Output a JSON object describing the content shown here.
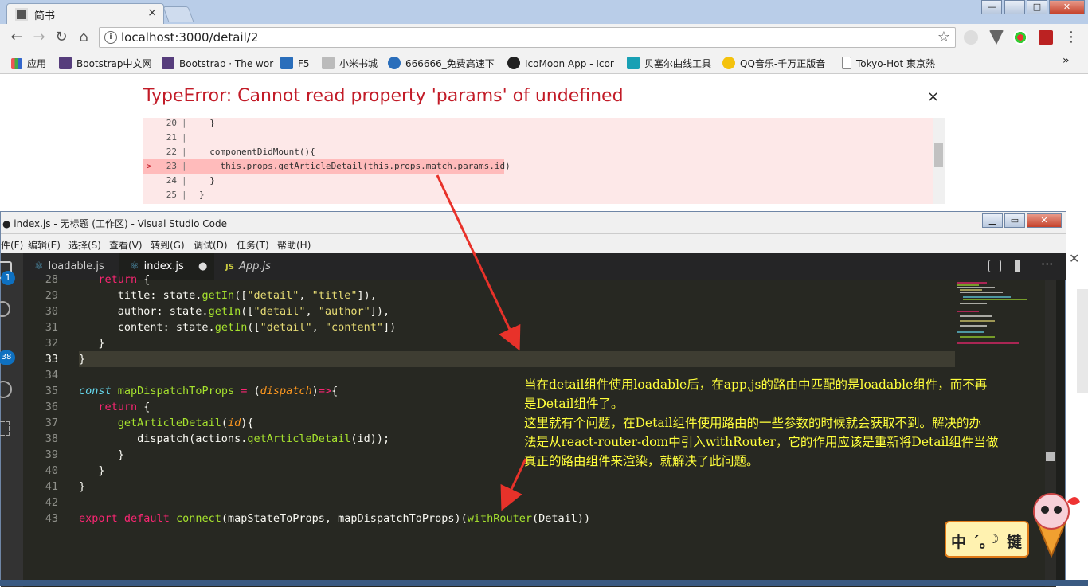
{
  "browser": {
    "tab_title": "简书",
    "tab_close": "×",
    "url": "localhost:3000/detail/2",
    "info_icon": "i",
    "star_icon": "☆",
    "window_controls": [
      "—",
      "□",
      "✕"
    ]
  },
  "bookmarks": [
    {
      "label": "应用",
      "icon_color": "#e55"
    },
    {
      "label": "Bootstrap中文网",
      "icon_color": "#563d7c"
    },
    {
      "label": "Bootstrap · The wor",
      "icon_color": "#563d7c"
    },
    {
      "label": "F5",
      "icon_color": "#2a6ebb"
    },
    {
      "label": "小米书城",
      "icon_color": "#aaa"
    },
    {
      "label": "666666_免费高速下",
      "icon_color": "#2a6ebb"
    },
    {
      "label": "IcoMoon App - Icor",
      "icon_color": "#222"
    },
    {
      "label": "贝塞尔曲线工具",
      "icon_color": "#18a0b4"
    },
    {
      "label": "QQ音乐-千万正版音",
      "icon_color": "#f4c20d"
    },
    {
      "label": "Tokyo-Hot 東京熱",
      "icon_color": "#888"
    }
  ],
  "bookmarks_more": "»",
  "error": {
    "title": "TypeError: Cannot read property 'params' of undefined",
    "close": "×",
    "marker": ">",
    "lines": [
      {
        "num": "20",
        "code": "  }"
      },
      {
        "num": "21",
        "code": ""
      },
      {
        "num": "22",
        "code": "  componentDidMount(){"
      },
      {
        "num": "23",
        "code": "    this.props.getArticleDetail(this.props.match.params.id)"
      },
      {
        "num": "24",
        "code": "  }"
      },
      {
        "num": "25",
        "code": "}"
      }
    ]
  },
  "vscode": {
    "title": "● index.js - 无标题 (工作区) - Visual Studio Code",
    "menus": [
      "件(F)",
      "编辑(E)",
      "选择(S)",
      "查看(V)",
      "转到(G)",
      "调试(D)",
      "任务(T)",
      "帮助(H)"
    ],
    "tabs": [
      {
        "label": "loadable.js"
      },
      {
        "label": "index.js",
        "dirty": "●"
      },
      {
        "label": "App.js",
        "prefix": "JS"
      }
    ],
    "badges": {
      "explorer": "1",
      "scm": "38"
    },
    "lines": [
      {
        "num": "28",
        "text": "   return {"
      },
      {
        "num": "29",
        "text": "      title: state.getIn([\"detail\", \"title\"]),"
      },
      {
        "num": "30",
        "text": "      author: state.getIn([\"detail\", \"author\"]),"
      },
      {
        "num": "31",
        "text": "      content: state.getIn([\"detail\", \"content\"])"
      },
      {
        "num": "32",
        "text": "   }"
      },
      {
        "num": "33",
        "text": "}"
      },
      {
        "num": "34",
        "text": ""
      },
      {
        "num": "35",
        "text": "const mapDispatchToProps = (dispatch)=>{"
      },
      {
        "num": "36",
        "text": "   return {"
      },
      {
        "num": "37",
        "text": "      getArticleDetail(id){"
      },
      {
        "num": "38",
        "text": "         dispatch(actions.getArticleDetail(id));"
      },
      {
        "num": "39",
        "text": "      }"
      },
      {
        "num": "40",
        "text": "   }"
      },
      {
        "num": "41",
        "text": "}"
      },
      {
        "num": "42",
        "text": ""
      },
      {
        "num": "43",
        "text": "export default connect(mapStateToProps, mapDispatchToProps)(withRouter(Detail))"
      }
    ]
  },
  "annotation": [
    "当在detail组件使用loadable后，在app.js的路由中匹配的是loadable组件，而不再",
    "是Detail组件了。",
    "这里就有个问题，在Detail组件使用路由的一些参数的时候就会获取不到。解决的办",
    "法是从react-router-dom中引入withRouter，它的作用应该是重新将Detail组件当做",
    "真正的路由组件来渲染，就解决了此问题。"
  ],
  "ime": {
    "label": "中",
    "extra": "´。",
    "key": "键"
  },
  "colors": {
    "error_red": "#c21b27",
    "arrow_red": "#e8322a",
    "note_yellow": "#ffff3c",
    "editor_bg": "#272822"
  }
}
